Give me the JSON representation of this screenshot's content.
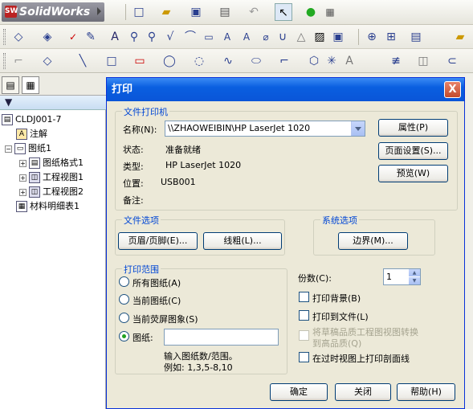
{
  "app": {
    "name": "SolidWorks"
  },
  "left_panel": {
    "tree": {
      "root": "CLDJ001-7",
      "annotation": "注解",
      "sheet": "图纸1",
      "sheet_format": "图纸格式1",
      "drawing_view1": "工程视图1",
      "drawing_view2": "工程视图2",
      "bom": "材料明细表1"
    }
  },
  "dialog": {
    "title": "打印",
    "close": "X",
    "printer_group": {
      "title": "文件打印机",
      "name_label": "名称(N):",
      "name_value": "\\\\ZHAOWEIBIN\\HP LaserJet 1020",
      "status_label": "状态:",
      "status_value": "准备就绪",
      "type_label": "类型:",
      "type_value": "HP LaserJet 1020",
      "location_label": "位置:",
      "location_value": "USB001",
      "comment_label": "备注:",
      "properties_btn": "属性(P)",
      "page_setup_btn": "页面设置(S)...",
      "preview_btn": "预览(W)"
    },
    "doc_options": {
      "title": "文件选项",
      "header_footer_btn": "页眉/页脚(E)...",
      "line_weight_btn": "线粗(L)..."
    },
    "sys_options": {
      "title": "系统选项",
      "margins_btn": "边界(M)..."
    },
    "print_range": {
      "title": "打印范围",
      "all_sheets": "所有图纸(A)",
      "current_sheet": "当前图纸(C)",
      "current_screen": "当前荧屏图象(S)",
      "sheets": "图纸:",
      "sheets_input": "",
      "hint1": "输入图纸数/范围。",
      "hint2": "例如: 1,3,5-8,10"
    },
    "copies_label": "份数(C):",
    "copies_value": "1",
    "print_background": "打印背景(B)",
    "print_to_file": "打印到文件(L)",
    "draft_to_high_1": "将草稿品质工程图视图转换",
    "draft_to_high_2": "到高品质(Q)",
    "print_crosshatch": "在过时视图上打印剖面线",
    "ok_btn": "确定",
    "cancel_btn": "关闭",
    "help_btn": "帮助(H)"
  }
}
